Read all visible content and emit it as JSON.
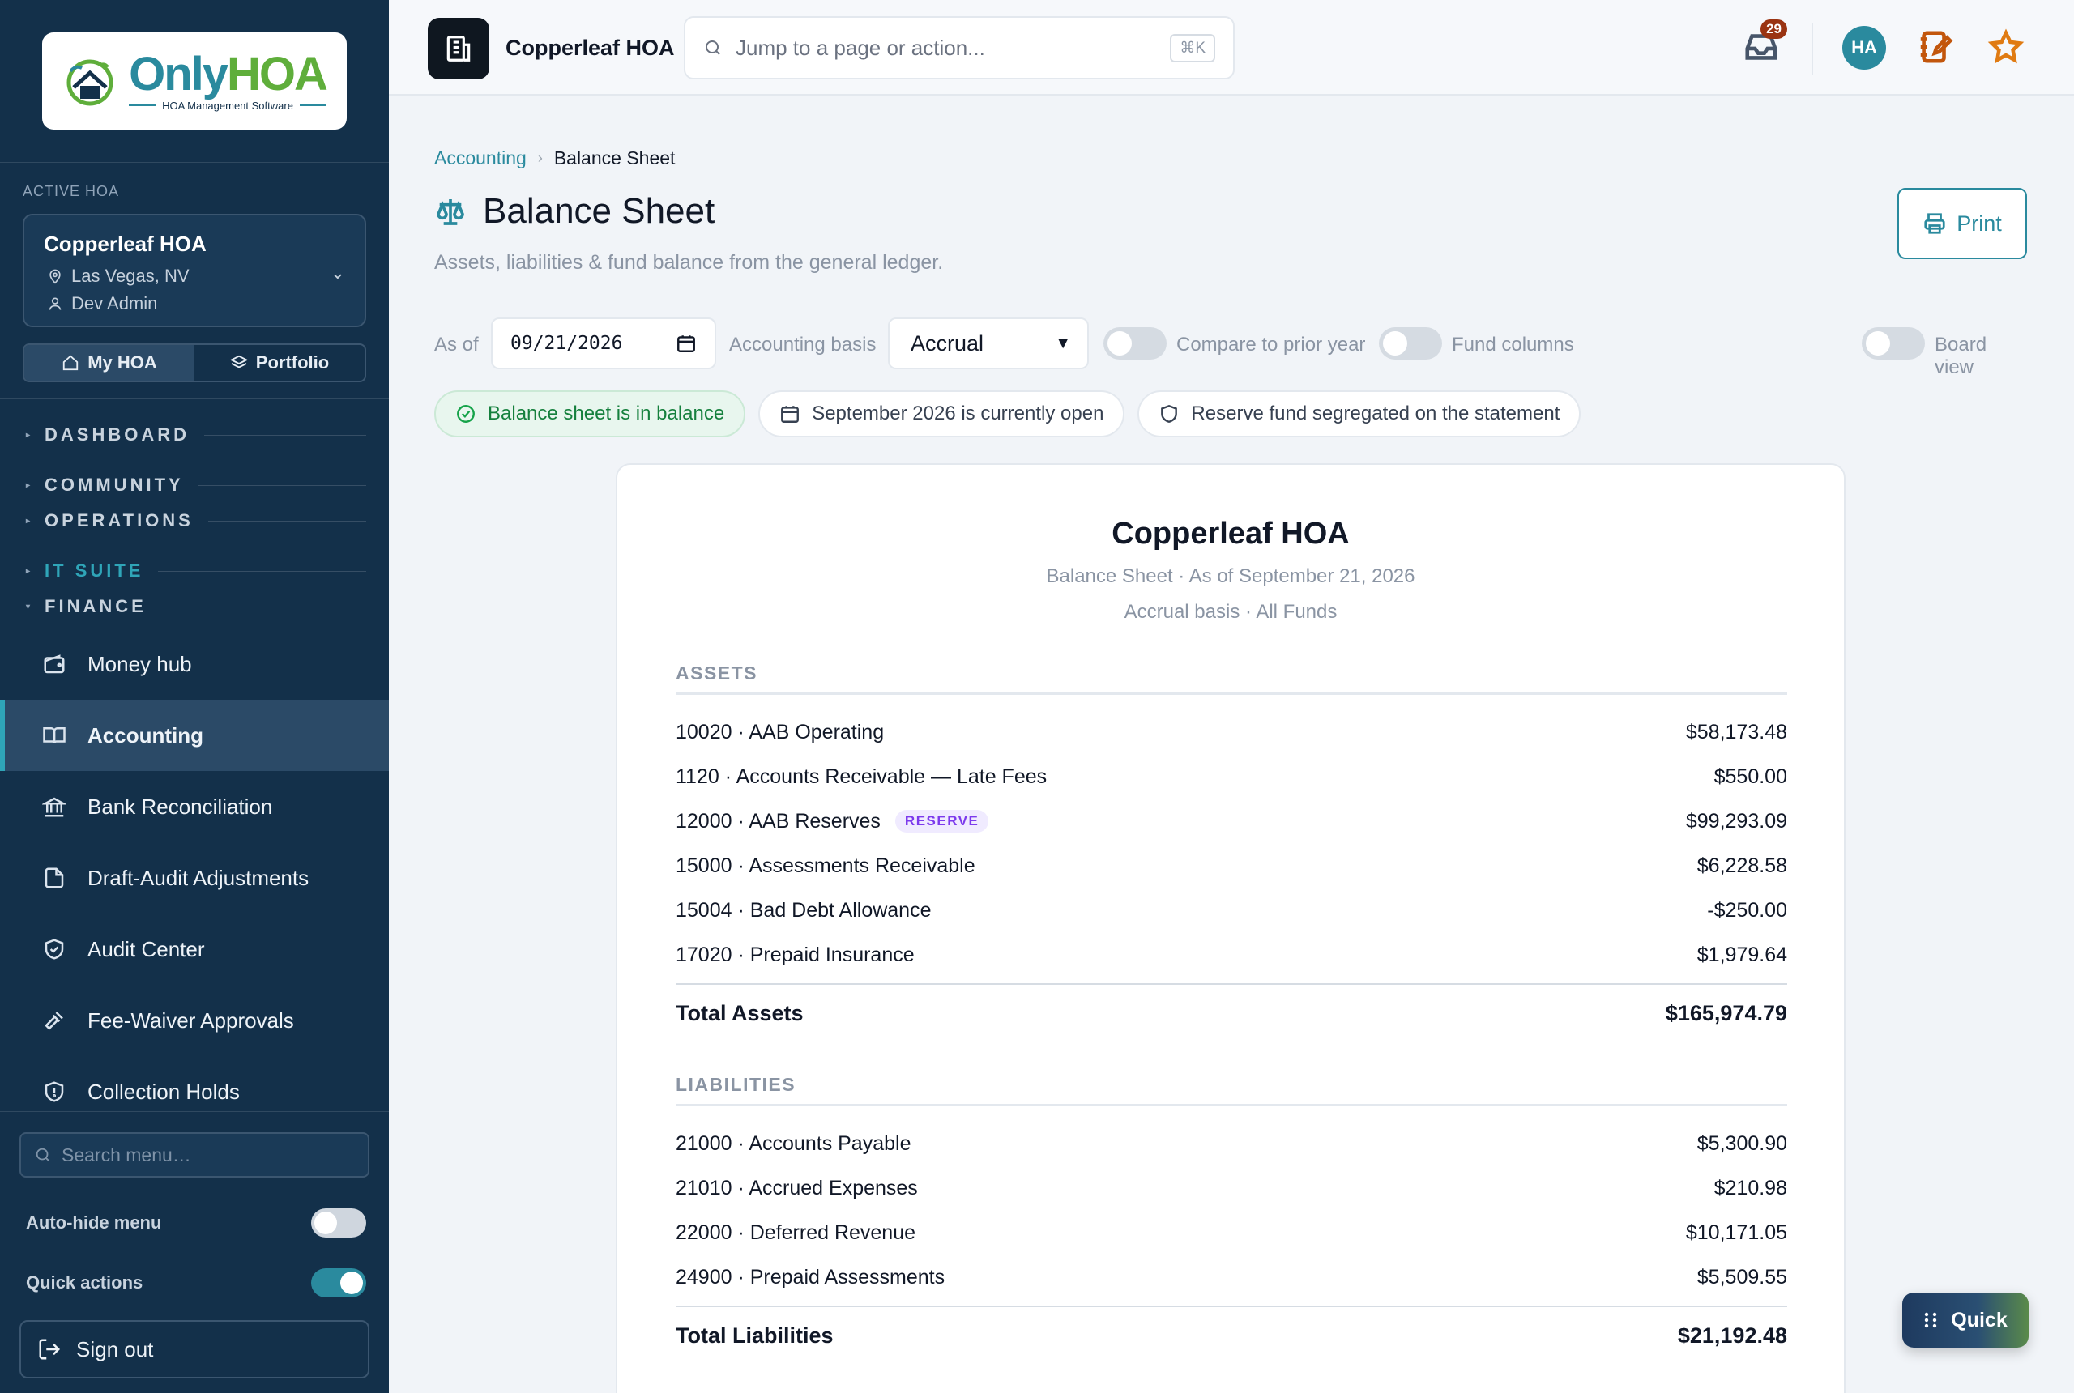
{
  "brand": {
    "logo_only": "Only",
    "logo_hoa": "HOA",
    "logo_tagline": "HOA Management Software"
  },
  "sidebar": {
    "active_hoa_label": "ACTIVE HOA",
    "hoa_name": "Copperleaf HOA",
    "hoa_location": "Las Vegas, NV",
    "hoa_user": "Dev Admin",
    "scope_tabs": [
      {
        "label": "My HOA",
        "icon": "home-icon"
      },
      {
        "label": "Portfolio",
        "icon": "layers-icon"
      }
    ],
    "sections": [
      "DASHBOARD",
      "COMMUNITY",
      "OPERATIONS",
      "IT SUITE",
      "FINANCE"
    ],
    "items": [
      {
        "label": "Money hub",
        "icon": "wallet-icon"
      },
      {
        "label": "Accounting",
        "icon": "book-open-icon"
      },
      {
        "label": "Bank Reconciliation",
        "icon": "bank-icon"
      },
      {
        "label": "Draft-Audit Adjustments",
        "icon": "file-edit-icon"
      },
      {
        "label": "Audit Center",
        "icon": "shield-check-icon"
      },
      {
        "label": "Fee-Waiver Approvals",
        "icon": "gavel-icon"
      },
      {
        "label": "Collection Holds",
        "icon": "shield-alert-icon"
      }
    ],
    "search_placeholder": "Search menu…",
    "auto_hide_label": "Auto-hide menu",
    "auto_hide_on": false,
    "quick_actions_label": "Quick actions",
    "quick_actions_on": true,
    "sign_out_label": "Sign out"
  },
  "topbar": {
    "app_name": "Copperleaf HOA",
    "jump_placeholder": "Jump to a page or action...",
    "jump_shortcut": "⌘K",
    "inbox_count": "29",
    "avatar_initials": "HA"
  },
  "breadcrumb": {
    "parent": "Accounting",
    "current": "Balance Sheet"
  },
  "page": {
    "title": "Balance Sheet",
    "subtitle": "Assets, liabilities & fund balance from the general ledger.",
    "print_label": "Print"
  },
  "filters": {
    "as_of_label": "As of",
    "as_of_value": "09/21/2026",
    "basis_label": "Accounting basis",
    "basis_value": "Accrual",
    "basis_options": [
      "Accrual"
    ],
    "compare_label": "Compare to prior year",
    "fund_columns_label": "Fund columns",
    "board_view_label": "Board view"
  },
  "status_chips": {
    "balanced": "Balance sheet is in balance",
    "period": "September 2026 is currently open",
    "reserve": "Reserve fund segregated on the statement"
  },
  "report": {
    "org": "Copperleaf HOA",
    "subtitle": "Balance Sheet · As of September 21, 2026",
    "basis_line": "Accrual basis · All Funds",
    "assets_heading": "ASSETS",
    "assets": [
      {
        "label": "10020 · AAB Operating",
        "amount": "$58,173.48"
      },
      {
        "label": "1120 · Accounts Receivable — Late Fees",
        "amount": "$550.00"
      },
      {
        "label": "12000 · AAB Reserves",
        "tag": "RESERVE",
        "amount": "$99,293.09"
      },
      {
        "label": "15000 · Assessments Receivable",
        "amount": "$6,228.58"
      },
      {
        "label": "15004 · Bad Debt Allowance",
        "amount": "-$250.00"
      },
      {
        "label": "17020 · Prepaid Insurance",
        "amount": "$1,979.64"
      }
    ],
    "total_assets_label": "Total Assets",
    "total_assets": "$165,974.79",
    "liabilities_heading": "LIABILITIES",
    "liabilities": [
      {
        "label": "21000 · Accounts Payable",
        "amount": "$5,300.90"
      },
      {
        "label": "21010 · Accrued Expenses",
        "amount": "$210.98"
      },
      {
        "label": "22000 · Deferred Revenue",
        "amount": "$10,171.05"
      },
      {
        "label": "24900 · Prepaid Assessments",
        "amount": "$5,509.55"
      }
    ],
    "total_liabilities_label": "Total Liabilities",
    "total_liabilities": "$21,192.48"
  },
  "quick_button": "Quick"
}
